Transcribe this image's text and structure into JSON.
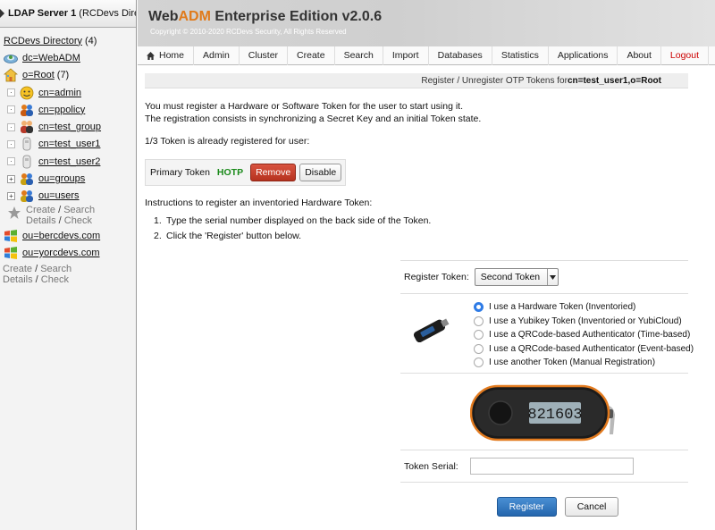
{
  "sidebar": {
    "server_title": "LDAP Server 1",
    "server_suffix": " (RCDevs Directory)",
    "root_label": "RCDevs Directory",
    "root_count": "(4)",
    "nodes": [
      {
        "label": "dc=WebADM",
        "count": ""
      },
      {
        "label": "o=Root",
        "count": "(7)"
      }
    ],
    "children": [
      {
        "label": "cn=admin"
      },
      {
        "label": "cn=ppolicy"
      },
      {
        "label": "cn=test_group"
      },
      {
        "label": "cn=test_user1"
      },
      {
        "label": "cn=test_user2"
      },
      {
        "label": "ou=groups"
      },
      {
        "label": "ou=users"
      }
    ],
    "inner_actions": {
      "create": "Create",
      "search": "Search",
      "details": "Details",
      "check": "Check",
      "sep": " / "
    },
    "org_nodes": [
      {
        "label": "ou=bercdevs.com"
      },
      {
        "label": "ou=yorcdevs.com"
      }
    ],
    "outer_actions": {
      "create": "Create",
      "search": "Search",
      "details": "Details",
      "check": "Check",
      "sep": " / "
    }
  },
  "header": {
    "brand_web": "Web",
    "brand_adm": "ADM",
    "brand_rest": " Enterprise Edition v2.0.6",
    "copyright": "Copyright © 2010-2020 RCDevs Security, All Rights Reserved"
  },
  "menu": [
    "Home",
    "Admin",
    "Cluster",
    "Create",
    "Search",
    "Import",
    "Databases",
    "Statistics",
    "Applications",
    "About",
    "Logout"
  ],
  "breadcrumb": {
    "prefix": "Register / Unregister OTP Tokens for ",
    "target": "cn=test_user1,o=Root"
  },
  "intro": {
    "line1": "You must register a Hardware or Software Token for the user to start using it.",
    "line2": "The registration consists in synchronizing a Secret Key and an initial Token state."
  },
  "status_text": "1/3 Token is already registered for user:",
  "token": {
    "label": "Primary Token",
    "type": "HOTP",
    "remove": "Remove",
    "disable": "Disable"
  },
  "instructions": {
    "title": "Instructions to register an inventoried Hardware Token:",
    "steps": [
      {
        "num": "1.",
        "text": "Type the serial number displayed on the back side of the Token."
      },
      {
        "num": "2.",
        "text": "Click the 'Register' button below."
      }
    ]
  },
  "form": {
    "register_label": "Register Token:",
    "selected_token": "Second Token",
    "options": [
      {
        "label": "I use a Hardware Token (Inventoried)",
        "selected": true
      },
      {
        "label": "I use a Yubikey Token (Inventoried or YubiCloud)",
        "selected": false
      },
      {
        "label": "I use a QRCode-based Authenticator (Time-based)",
        "selected": false
      },
      {
        "label": "I use a QRCode-based Authenticator (Event-based)",
        "selected": false
      },
      {
        "label": "I use another Token (Manual Registration)",
        "selected": false
      }
    ],
    "keyfob_display": "821603",
    "serial_label": "Token Serial:",
    "serial_value": "",
    "register_button": "Register",
    "cancel_button": "Cancel"
  },
  "colors": {
    "accent_orange": "#e07a1a",
    "hotp_green": "#1a8a1a",
    "remove_red": "#b6321f",
    "register_blue": "#2466ad",
    "radio_blue": "#2e7be6",
    "logout_red": "#cc0000"
  }
}
